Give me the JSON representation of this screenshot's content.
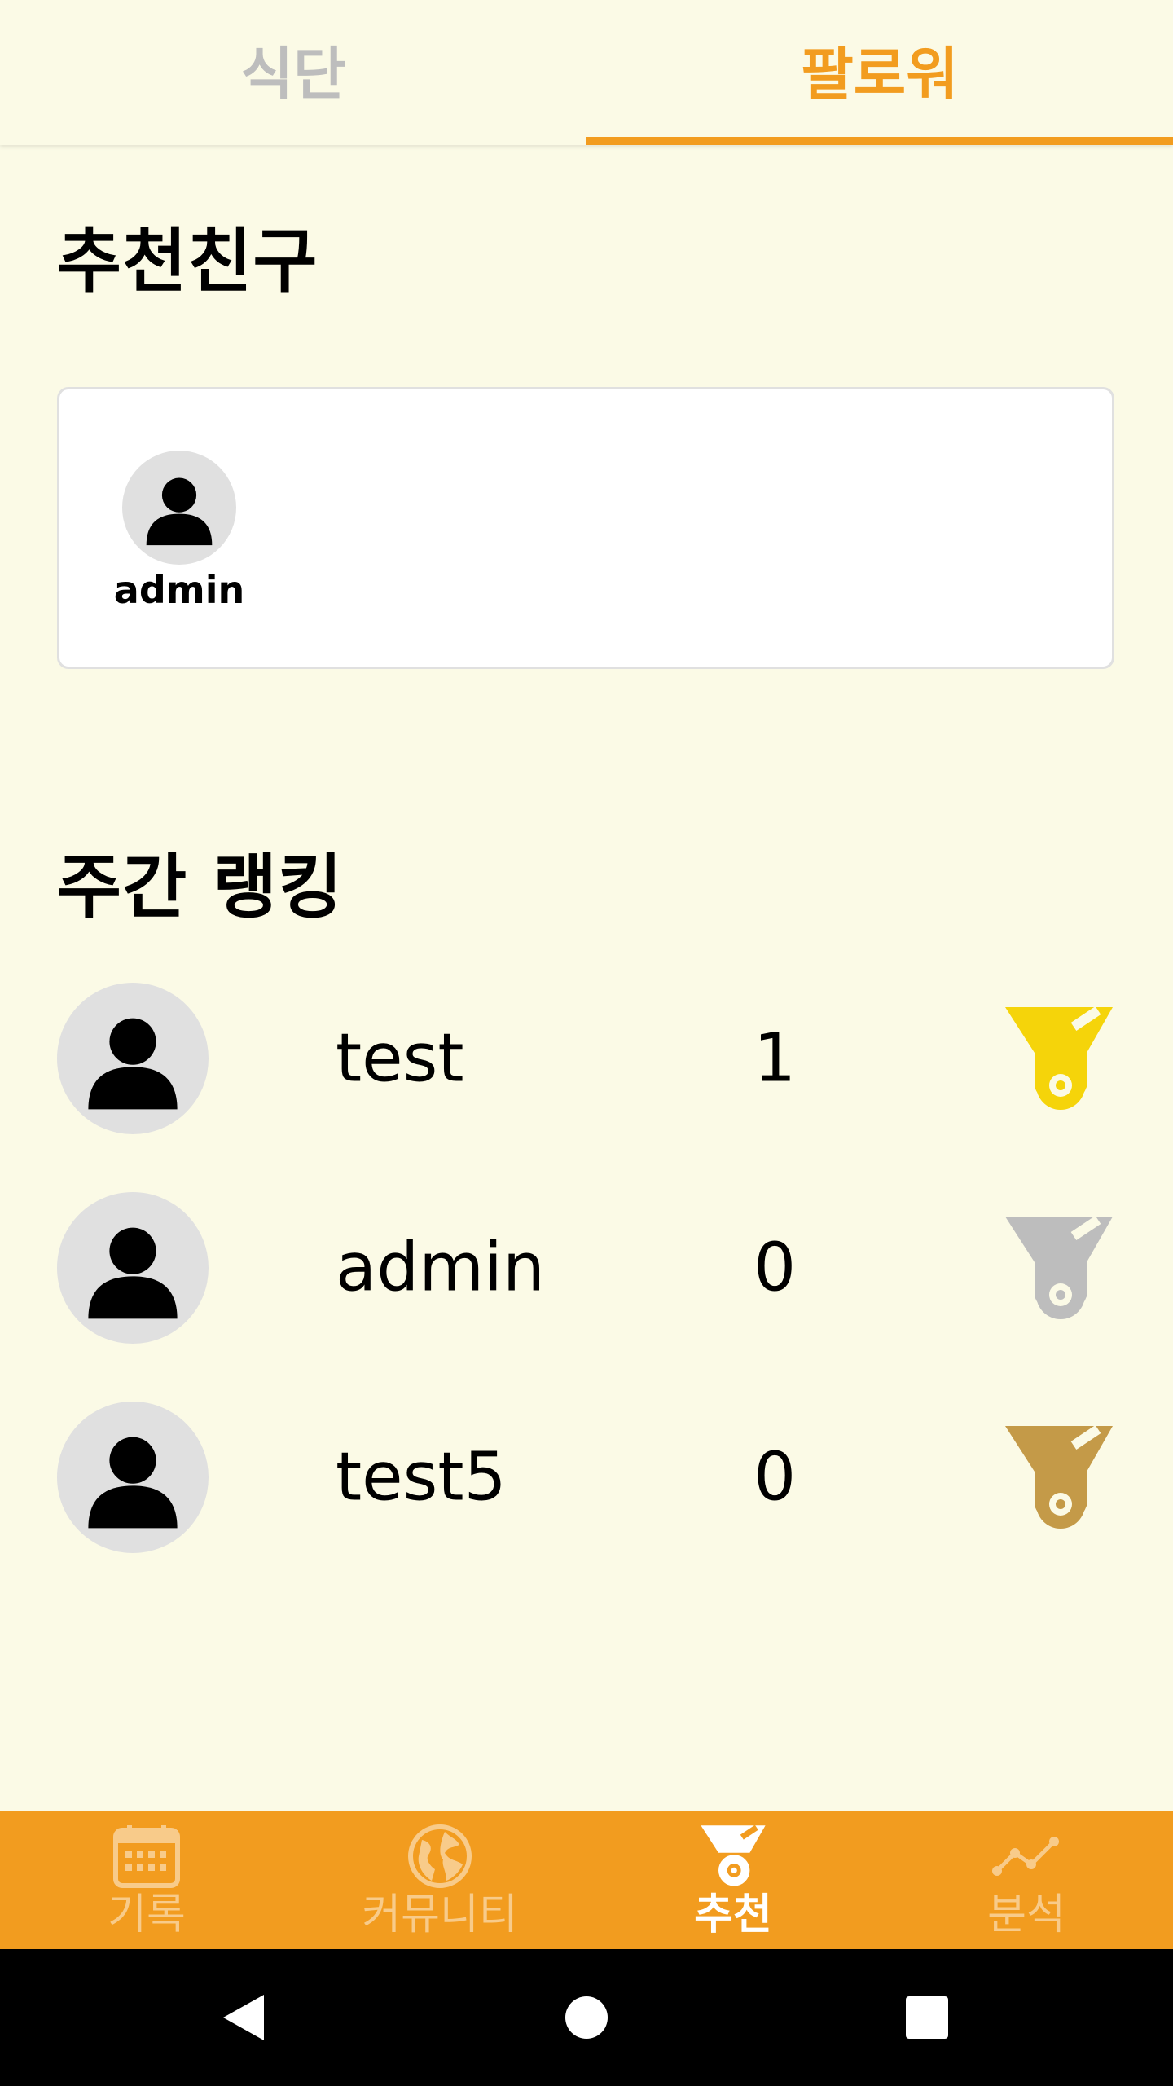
{
  "top_tabs": [
    {
      "label": "식단",
      "active": false
    },
    {
      "label": "팔로워",
      "active": true
    }
  ],
  "recommend": {
    "title": "추천친구",
    "friends": [
      {
        "name": "admin"
      }
    ]
  },
  "ranking": {
    "title": "주간 랭킹",
    "rows": [
      {
        "name": "test",
        "count": "1",
        "medal": "gold-medal-icon",
        "medal_color": "#F5D40A"
      },
      {
        "name": "admin",
        "count": "0",
        "medal": "silver-medal-icon",
        "medal_color": "#BDBDBD"
      },
      {
        "name": "test5",
        "count": "0",
        "medal": "bronze-medal-icon",
        "medal_color": "#C49A48"
      }
    ]
  },
  "bottom_nav": [
    {
      "label": "기록",
      "icon": "calendar-icon",
      "active": false
    },
    {
      "label": "커뮤니티",
      "icon": "globe-icon",
      "active": false
    },
    {
      "label": "추천",
      "icon": "medal-icon",
      "active": true
    },
    {
      "label": "분석",
      "icon": "chart-line-icon",
      "active": false
    }
  ],
  "colors": {
    "accent": "#F29C1F",
    "background": "#FBFAE6",
    "inactive_tab": "#BDBDBD",
    "inactive_nav": "#F8CB8A"
  },
  "system_nav": {
    "back": "back-icon",
    "home": "home-icon",
    "recents": "recents-icon"
  }
}
